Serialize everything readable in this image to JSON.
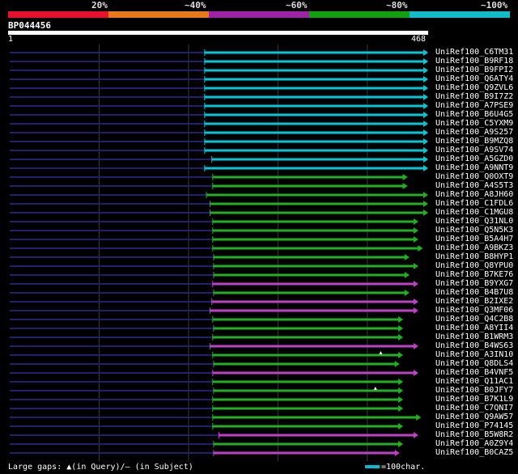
{
  "legend": {
    "segments": [
      {
        "color": "#e8102a"
      },
      {
        "color": "#e87818"
      },
      {
        "color": "#a022a8"
      },
      {
        "color": "#10a010"
      },
      {
        "color": "#10bcc8"
      }
    ],
    "labels": [
      "20%",
      "~40%",
      "~60%",
      "~80%",
      "~100%"
    ]
  },
  "query": {
    "name": "BP044456",
    "start": "1",
    "end": "468",
    "length": 468
  },
  "scale": {
    "max": 468
  },
  "colors": {
    "cyan": "#00c8d8",
    "green": "#20b020",
    "magenta": "#c040c8",
    "background_line": "#202070"
  },
  "hits": [
    {
      "name": "UniRef100_C6TM31",
      "start": 218,
      "end": 468,
      "color": "cyan"
    },
    {
      "name": "UniRef100_B9RF18",
      "start": 218,
      "end": 468,
      "color": "cyan"
    },
    {
      "name": "UniRef100_B9FPI2",
      "start": 218,
      "end": 468,
      "color": "cyan"
    },
    {
      "name": "UniRef100_Q6ATY4",
      "start": 218,
      "end": 468,
      "color": "cyan"
    },
    {
      "name": "UniRef100_Q9ZVL6",
      "start": 218,
      "end": 468,
      "color": "cyan"
    },
    {
      "name": "UniRef100_B9I7Z2",
      "start": 218,
      "end": 468,
      "color": "cyan"
    },
    {
      "name": "UniRef100_A7PSE9",
      "start": 218,
      "end": 468,
      "color": "cyan"
    },
    {
      "name": "UniRef100_B6U4G5",
      "start": 218,
      "end": 468,
      "color": "cyan"
    },
    {
      "name": "UniRef100_C5YXM9",
      "start": 218,
      "end": 468,
      "color": "cyan"
    },
    {
      "name": "UniRef100_A9S257",
      "start": 218,
      "end": 468,
      "color": "cyan"
    },
    {
      "name": "UniRef100_B9MZQ8",
      "start": 218,
      "end": 468,
      "color": "cyan"
    },
    {
      "name": "UniRef100_A9SV74",
      "start": 218,
      "end": 468,
      "color": "cyan"
    },
    {
      "name": "UniRef100_A5GZD0",
      "start": 226,
      "end": 468,
      "color": "cyan"
    },
    {
      "name": "UniRef100_A9NNT9",
      "start": 218,
      "end": 468,
      "color": "cyan"
    },
    {
      "name": "UniRef100_Q0OXT9",
      "start": 227,
      "end": 445,
      "color": "green"
    },
    {
      "name": "UniRef100_A4S5T3",
      "start": 227,
      "end": 445,
      "color": "green"
    },
    {
      "name": "UniRef100_A8JH60",
      "start": 220,
      "end": 468,
      "color": "green"
    },
    {
      "name": "UniRef100_C1FDL6",
      "start": 224,
      "end": 468,
      "color": "green"
    },
    {
      "name": "UniRef100_C1MGU8",
      "start": 224,
      "end": 468,
      "color": "green"
    },
    {
      "name": "UniRef100_Q31NL0",
      "start": 227,
      "end": 457,
      "color": "green"
    },
    {
      "name": "UniRef100_Q5N5K3",
      "start": 227,
      "end": 457,
      "color": "green"
    },
    {
      "name": "UniRef100_B5A4H7",
      "start": 227,
      "end": 457,
      "color": "green"
    },
    {
      "name": "UniRef100_A9BKZ3",
      "start": 227,
      "end": 462,
      "color": "green"
    },
    {
      "name": "UniRef100_B8HYP1",
      "start": 228,
      "end": 447,
      "color": "green"
    },
    {
      "name": "UniRef100_Q8YPU0",
      "start": 228,
      "end": 457,
      "color": "green"
    },
    {
      "name": "UniRef100_B7KE76",
      "start": 228,
      "end": 447,
      "color": "green"
    },
    {
      "name": "UniRef100_B9YXG7",
      "start": 227,
      "end": 457,
      "color": "magenta"
    },
    {
      "name": "UniRef100_B4B7U8",
      "start": 228,
      "end": 447,
      "color": "green"
    },
    {
      "name": "UniRef100_B2IXE2",
      "start": 226,
      "end": 457,
      "color": "magenta"
    },
    {
      "name": "UniRef100_Q3MF06",
      "start": 224,
      "end": 457,
      "color": "magenta"
    },
    {
      "name": "UniRef100_Q4C2B8",
      "start": 227,
      "end": 440,
      "color": "green"
    },
    {
      "name": "UniRef100_A8YII4",
      "start": 228,
      "end": 440,
      "color": "green"
    },
    {
      "name": "UniRef100_B1WRM3",
      "start": 227,
      "end": 440,
      "color": "green"
    },
    {
      "name": "UniRef100_B4WS63",
      "start": 224,
      "end": 457,
      "color": "magenta"
    },
    {
      "name": "UniRef100_A3IN10",
      "start": 227,
      "end": 440,
      "color": "green"
    },
    {
      "name": "UniRef100_Q8DLS4",
      "start": 228,
      "end": 436,
      "color": "green"
    },
    {
      "name": "UniRef100_B4VNF5",
      "start": 227,
      "end": 457,
      "color": "magenta"
    },
    {
      "name": "UniRef100_Q11AC1",
      "start": 227,
      "end": 440,
      "color": "green"
    },
    {
      "name": "UniRef100_B0JFY7",
      "start": 228,
      "end": 440,
      "color": "green"
    },
    {
      "name": "UniRef100_B7K1L9",
      "start": 227,
      "end": 440,
      "color": "green"
    },
    {
      "name": "UniRef100_C7QNI7",
      "start": 227,
      "end": 440,
      "color": "green"
    },
    {
      "name": "UniRef100_Q9AW57",
      "start": 227,
      "end": 460,
      "color": "green"
    },
    {
      "name": "UniRef100_P74145",
      "start": 227,
      "end": 440,
      "color": "green"
    },
    {
      "name": "UniRef100_B5W8R2",
      "start": 234,
      "end": 457,
      "color": "magenta"
    },
    {
      "name": "UniRef100_A0Z9Y4",
      "start": 228,
      "end": 440,
      "color": "green"
    },
    {
      "name": "UniRef100_B0CAZ5",
      "start": 228,
      "end": 436,
      "color": "magenta"
    }
  ],
  "gap_marks": [
    {
      "hit_index": 33,
      "position": 415
    },
    {
      "hit_index": 37,
      "position": 409
    }
  ],
  "footer": {
    "gaps_text": "Large gaps:",
    "query_symbol": "▲",
    "query_note": "(in Query)/–",
    "subject_note": "(in Subject)",
    "scale_label": "=100char."
  }
}
